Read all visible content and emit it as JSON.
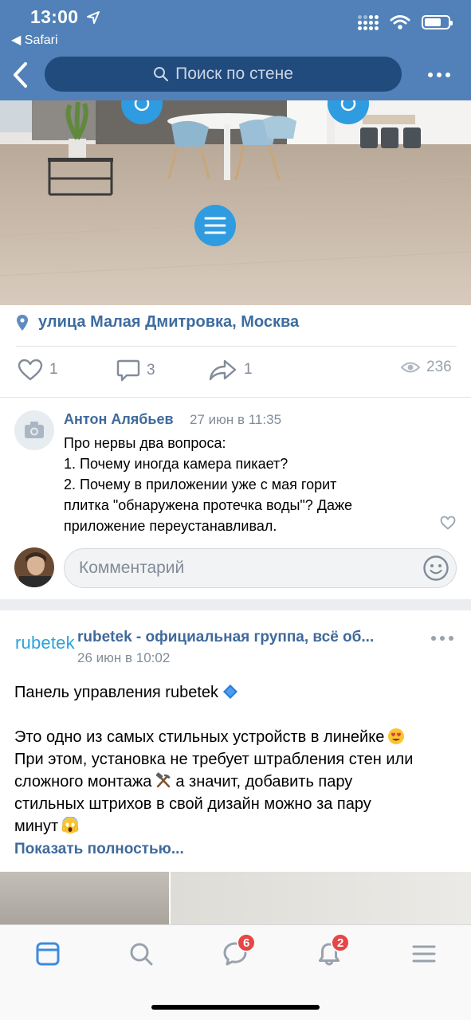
{
  "status_bar": {
    "time": "13:00",
    "back_app": "Safari"
  },
  "header": {
    "search_placeholder": "Поиск по стене"
  },
  "post1": {
    "location": "улица Малая Дмитровка, Москва",
    "likes": "1",
    "comments": "3",
    "shares": "1",
    "views": "236"
  },
  "comment": {
    "author": "Антон Алябьев",
    "date": "27 июн в 11:35",
    "lines": [
      "Про нервы два вопроса:",
      "1. Почему иногда камера пикает?",
      "2. Почему в приложении уже с мая горит",
      "плитка \"обнаружена протечка воды\"? Даже",
      "приложение переустанавливал."
    ]
  },
  "comment_input": {
    "placeholder": "Комментарий"
  },
  "post2": {
    "logo_text": "rubetek",
    "group_name": "rubetek - официальная группа, всё об...",
    "date": "26 июн в 10:02",
    "text_lines": [
      {
        "text": "Панель управления rubetek",
        "emoji": "blue-diamond"
      },
      {
        "text": "",
        "emoji": ""
      },
      {
        "text": "Это одно из самых стильных устройств в линейке",
        "emoji": "heart-eyes"
      },
      {
        "text": "При этом, установка не требует штрабления стен или",
        "emoji": ""
      },
      {
        "text": "сложного монтажа",
        "emoji": "hammer-pick",
        "after": "а значит, добавить пару"
      },
      {
        "text": "стильных штрихов в свой дизайн можно за пару",
        "emoji": ""
      },
      {
        "text": "минут",
        "emoji": "scream"
      }
    ],
    "show_more": "Показать полностью..."
  },
  "tabbar": {
    "tabs": [
      {
        "name": "news",
        "icon": "feed-icon",
        "active": true,
        "badge": ""
      },
      {
        "name": "search",
        "icon": "search-icon",
        "active": false,
        "badge": ""
      },
      {
        "name": "messages",
        "icon": "message-icon",
        "active": false,
        "badge": "6"
      },
      {
        "name": "notifications",
        "icon": "bell-icon",
        "active": false,
        "badge": "2"
      },
      {
        "name": "menu",
        "icon": "menu-icon",
        "active": false,
        "badge": ""
      }
    ]
  },
  "colors": {
    "header_bg": "#5181b8",
    "link": "#3f6a9b",
    "secondary_text": "#818c99",
    "tab_active": "#3f8ae0",
    "tab_inactive": "#99a2ad",
    "badge": "#e64646",
    "logo": "#2aa3d8"
  }
}
